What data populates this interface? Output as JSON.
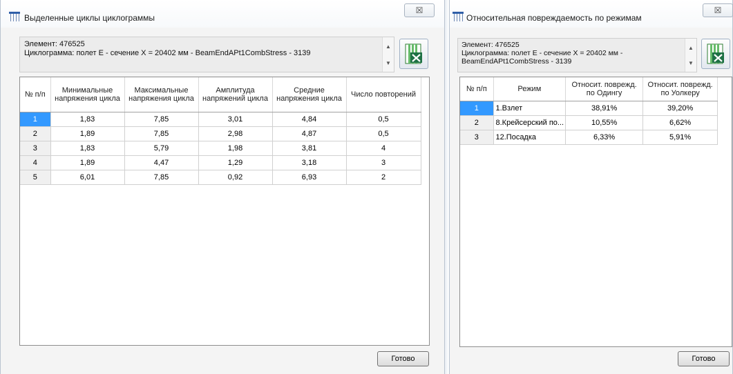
{
  "left_window": {
    "title": "Выделенные циклы циклограммы",
    "close_label": "☒",
    "info": {
      "line1": "Элемент: 476525",
      "line2": "Циклограмма: полет E - сечение X = 20402 мм - BeamEndAPt1CombStress - 3139"
    },
    "table": {
      "headers": [
        "№ п/п",
        "Минимальные напряжения цикла",
        "Максимальные напряжения цикла",
        "Амплитуда напряжений цикла",
        "Средние напряжения цикла",
        "Число повторений"
      ],
      "rows": [
        [
          "1",
          "1,83",
          "7,85",
          "3,01",
          "4,84",
          "0,5"
        ],
        [
          "2",
          "1,89",
          "7,85",
          "2,98",
          "4,87",
          "0,5"
        ],
        [
          "3",
          "1,83",
          "5,79",
          "1,98",
          "3,81",
          "4"
        ],
        [
          "4",
          "1,89",
          "4,47",
          "1,29",
          "3,18",
          "3"
        ],
        [
          "5",
          "6,01",
          "7,85",
          "0,92",
          "6,93",
          "2"
        ]
      ]
    },
    "ok_label": "Готово"
  },
  "right_window": {
    "title": "Относительная повреждаемость по режимам",
    "close_label": "☒",
    "info": {
      "line1": "Элемент: 476525",
      "line2": "Циклограмма: полет E - сечение X = 20402 мм -",
      "line3": "BeamEndAPt1CombStress - 3139"
    },
    "table": {
      "headers": [
        "№ п/п",
        "Режим",
        "Относит. поврежд. по Одингу",
        "Относит. поврежд. по Уолкеру"
      ],
      "rows": [
        [
          "1",
          "1.Взлет",
          "38,91%",
          "39,20%"
        ],
        [
          "2",
          "8.Крейсерский по...",
          "10,55%",
          "6,62%"
        ],
        [
          "3",
          "12.Посадка",
          "6,33%",
          "5,91%"
        ]
      ]
    },
    "ok_label": "Готово"
  },
  "icons": {
    "window": "window-icon",
    "excel": "excel-export-icon",
    "scroll_up": "scroll-up-icon",
    "scroll_down": "scroll-down-icon",
    "close": "close-icon"
  },
  "colors": {
    "selection": "#3399ff",
    "excel_green": "#1e7145"
  }
}
